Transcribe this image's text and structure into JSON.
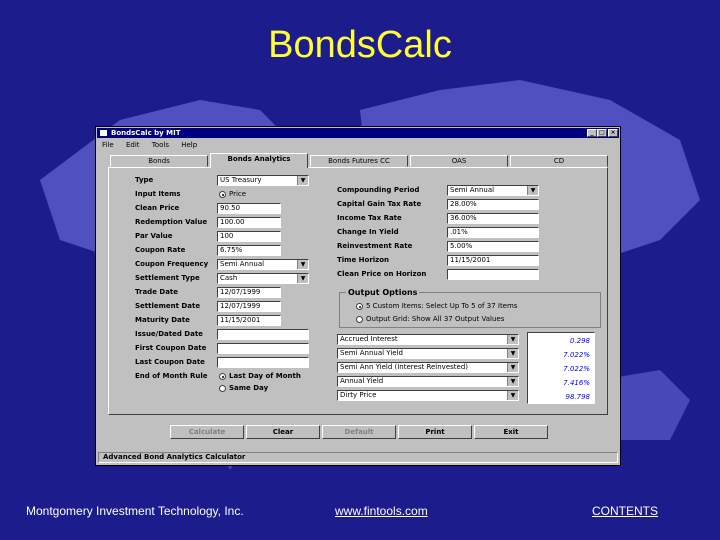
{
  "slide": {
    "title": "BondsCalc",
    "footer_left": "Montgomery Investment Technology, Inc.",
    "footer_center": "www.fintools.com",
    "footer_right": "CONTENTS"
  },
  "window": {
    "title": "BondsCalc by MIT",
    "controls": [
      "_",
      "□",
      "×"
    ],
    "menu": [
      "File",
      "Edit",
      "Tools",
      "Help"
    ],
    "status": "Advanced Bond Analytics Calculator"
  },
  "tabs": [
    {
      "label": "Bonds",
      "active": false
    },
    {
      "label": "Bonds Analytics",
      "active": true
    },
    {
      "label": "Bonds Futures CC",
      "active": false
    },
    {
      "label": "OAS",
      "active": false
    },
    {
      "label": "CD",
      "active": false
    }
  ],
  "left_fields": {
    "type": {
      "label": "Type",
      "value": "US Treasury"
    },
    "input_items": {
      "label": "Input Items",
      "value": "Price"
    },
    "clean_price": {
      "label": "Clean Price",
      "value": "90.50"
    },
    "redemption_value": {
      "label": "Redemption Value",
      "value": "100.00"
    },
    "par_value": {
      "label": "Par Value",
      "value": "100"
    },
    "coupon_rate": {
      "label": "Coupon Rate",
      "value": "6.75%"
    },
    "coupon_frequency": {
      "label": "Coupon Frequency",
      "value": "Semi Annual"
    },
    "settlement_type": {
      "label": "Settlement Type",
      "value": "Cash"
    },
    "trade_date": {
      "label": "Trade Date",
      "value": "12/07/1999"
    },
    "settlement_date": {
      "label": "Settlement Date",
      "value": "12/07/1999"
    },
    "maturity_date": {
      "label": "Maturity Date",
      "value": "11/15/2001"
    },
    "issue_dated_date": {
      "label": "Issue/Dated Date",
      "value": ""
    },
    "first_coupon_date": {
      "label": "First Coupon Date",
      "value": ""
    },
    "last_coupon_date": {
      "label": "Last Coupon Date",
      "value": ""
    },
    "end_of_month_rule": {
      "label": "End of Month Rule",
      "opt1": "Last Day of Month",
      "opt2": "Same Day"
    }
  },
  "right_fields": {
    "compounding_period": {
      "label": "Compounding Period",
      "value": "Semi Annual"
    },
    "capital_gain_tax_rate": {
      "label": "Capital Gain Tax Rate",
      "value": "28.00%"
    },
    "income_tax_rate": {
      "label": "Income Tax Rate",
      "value": "36.00%"
    },
    "change_in_yield": {
      "label": "Change In Yield",
      "value": ".01%"
    },
    "reinvestment_rate": {
      "label": "Reinvestment Rate",
      "value": "5.00%"
    },
    "time_horizon": {
      "label": "Time Horizon",
      "value": "11/15/2001"
    },
    "clean_price_on_horizon": {
      "label": "Clean Price on Horizon",
      "value": ""
    }
  },
  "output_options": {
    "label": "Output Options",
    "opt1": "5 Custom Items: Select Up To 5 of 37 Items",
    "opt2": "Output Grid: Show All 37 Output Values"
  },
  "results": [
    {
      "item": "Accrued Interest",
      "value": "0.298"
    },
    {
      "item": "Semi Annual Yield",
      "value": "7.022%"
    },
    {
      "item": "Semi Ann Yield (Interest Reinvested)",
      "value": "7.022%"
    },
    {
      "item": "Annual Yield",
      "value": "7.416%"
    },
    {
      "item": "Dirty Price",
      "value": "98.798"
    }
  ],
  "buttons": {
    "calculate": "Calculate",
    "clear": "Clear",
    "default": "Default",
    "print": "Print",
    "exit": "Exit"
  },
  "colors": {
    "background": "#1c1c8c",
    "title": "#ffff33",
    "window": "#c0c0c0",
    "titlebar": "#00007f",
    "result_text": "#0000ff"
  }
}
